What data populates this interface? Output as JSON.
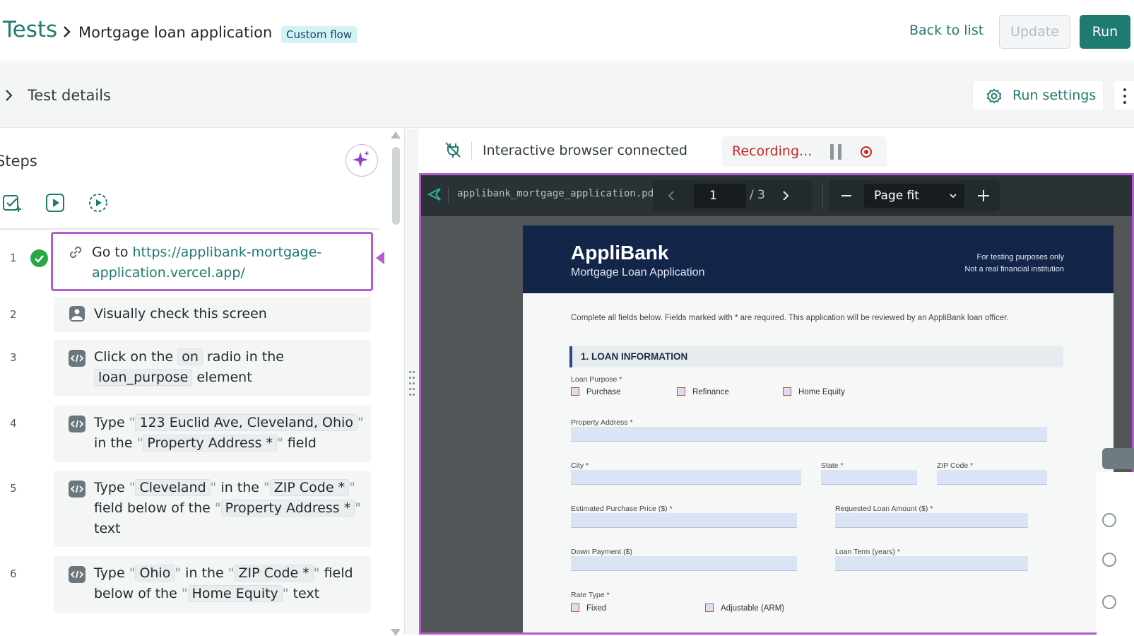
{
  "header": {
    "breadcrumb_root": "Tests",
    "title": "Mortgage loan application",
    "tag": "Custom flow",
    "back_label": "Back to list",
    "update_label": "Update",
    "run_label": "Run"
  },
  "details": {
    "label": "Test details",
    "run_settings_label": "Run settings"
  },
  "steps": {
    "title": "Steps",
    "items": [
      {
        "num": "1",
        "status": "passed",
        "icon": "link-icon",
        "prefix": "Go to ",
        "link": "https://applibank-mortgage-application.vercel.app/",
        "link_line1": "https://applibank-mortgage-",
        "link_line2": "application.vercel.app/"
      },
      {
        "num": "2",
        "icon": "image-icon",
        "text": "Visually check this screen"
      },
      {
        "num": "3",
        "icon": "code-icon",
        "t1": "Click on the ",
        "c1": "on",
        "t2": " radio in the",
        "c2": "loan_purpose",
        "t3": " element"
      },
      {
        "num": "4",
        "icon": "code-icon",
        "t1": "Type ",
        "c1": "123 Euclid Ave, Cleveland, Ohio",
        "t2": "in the ",
        "c2": "Property Address *",
        "t3": " field"
      },
      {
        "num": "5",
        "icon": "code-icon",
        "t1": "Type ",
        "c1": "Cleveland",
        "t2": " in the ",
        "c2": "ZIP Code *",
        "t3": "field below of the ",
        "c3": "Property Address *",
        "t4": "text"
      },
      {
        "num": "6",
        "icon": "code-icon",
        "t1": "Type ",
        "c1": "Ohio",
        "t2": " in the ",
        "c2": "ZIP Code *",
        "t3": " field",
        "t4": "below of the ",
        "c3": "Home Equity",
        "t5": " text"
      }
    ]
  },
  "browser": {
    "status": "Interactive browser connected",
    "recording": "Recording..."
  },
  "pdf": {
    "filename": "applibank_mortgage_application.pdf",
    "page": "1",
    "total": "/ 3",
    "zoom": "Page fit",
    "bank": "AppliBank",
    "subtitle": "Mortgage Loan Application",
    "note1": "For testing purposes only",
    "note2": "Not a real financial institution",
    "intro": "Complete all fields below. Fields marked with * are required. This application will be reviewed by an AppliBank loan officer.",
    "section": "1. LOAN INFORMATION",
    "loan_purpose_label": "Loan Purpose *",
    "purpose_options": [
      "Purchase",
      "Refinance",
      "Home Equity"
    ],
    "property_address": "Property Address *",
    "city": "City *",
    "state": "State *",
    "zip": "ZIP Code *",
    "est_price": "Estimated Purchase Price ($) *",
    "req_amount": "Requested Loan Amount ($) *",
    "down_payment": "Down Payment ($)",
    "loan_term": "Loan Term (years) *",
    "rate_type": "Rate Type *",
    "rate_options": [
      "Fixed",
      "Adjustable (ARM)"
    ]
  },
  "colors": {
    "accent": "#1f7a6f",
    "highlight": "#b45bcf",
    "recording": "#c62828",
    "pdf_header": "#13264a"
  }
}
